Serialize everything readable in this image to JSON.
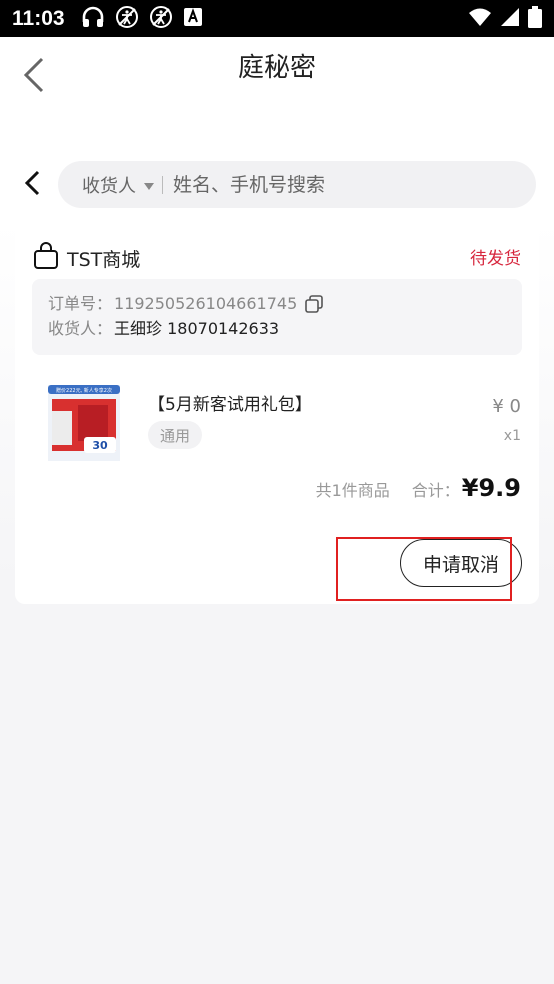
{
  "status_bar": {
    "time": "11:03",
    "icons": [
      "headset-icon",
      "a11y-off-icon",
      "a11y-off-icon",
      "font-a-icon"
    ],
    "right_icons": [
      "wifi-icon",
      "signal-icon",
      "battery-icon"
    ]
  },
  "nav": {
    "title": "庭秘密"
  },
  "search": {
    "filter_label": "收货人",
    "placeholder": "姓名、手机号搜索"
  },
  "order": {
    "shop_name": "TST商城",
    "status": "待发货",
    "order_no_label": "订单号：",
    "order_no": "119250526104661745",
    "receiver_label": "收货人：",
    "receiver": "王细珍 18070142633",
    "product": {
      "thumb_caption": "赠价222元, 新人专享2次",
      "thumb_badge": "30",
      "title": "【5月新客试用礼包】",
      "tag": "通用",
      "price": "¥ 0",
      "qty": "x1"
    },
    "summary": {
      "count_text": "共1件商品",
      "total_label": "合计：",
      "total_amount": "¥9.9"
    },
    "cancel_label": "申请取消"
  },
  "colors": {
    "status_red": "#d7263d",
    "highlight_red": "#e02020",
    "background": "#f5f5f7"
  }
}
